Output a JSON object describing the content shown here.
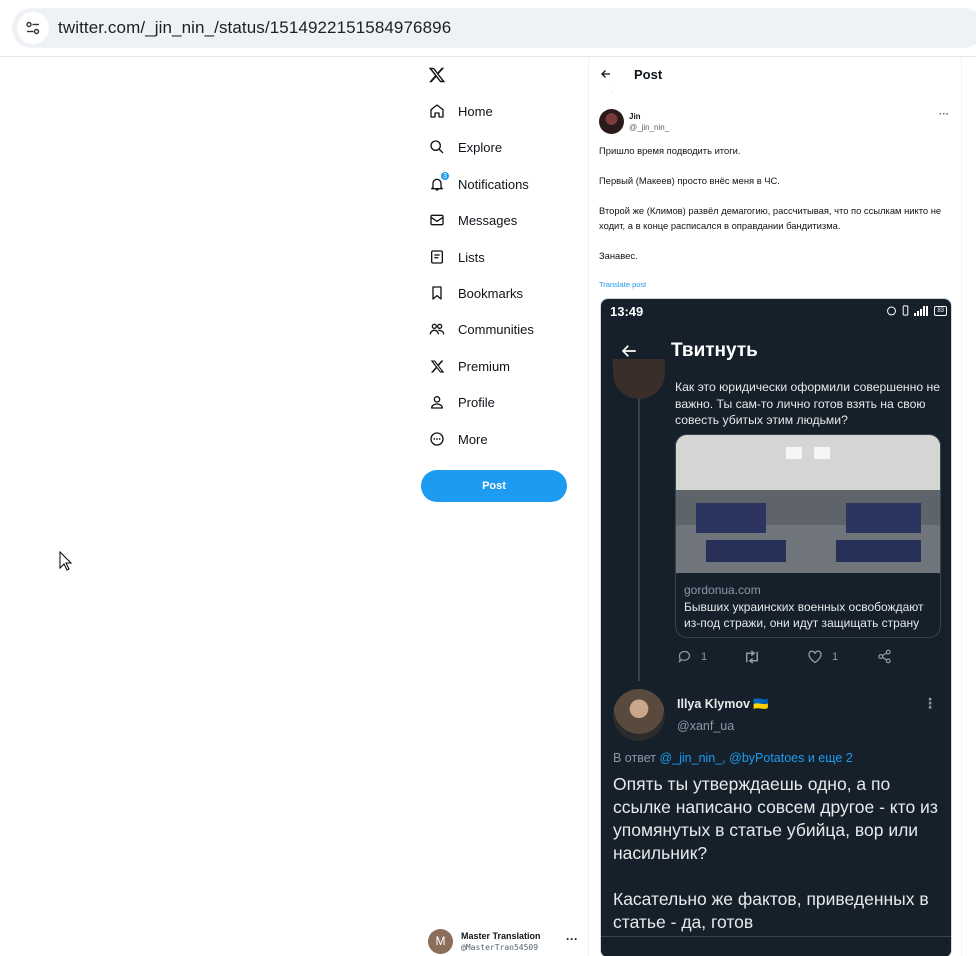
{
  "browser": {
    "url": "twitter.com/_jin_nin_/status/1514922151584976896"
  },
  "nav": {
    "items": [
      {
        "label": "Home",
        "icon": "home-icon"
      },
      {
        "label": "Explore",
        "icon": "search-icon"
      },
      {
        "label": "Notifications",
        "icon": "bell-icon",
        "badge": "3"
      },
      {
        "label": "Messages",
        "icon": "envelope-icon"
      },
      {
        "label": "Lists",
        "icon": "list-icon"
      },
      {
        "label": "Bookmarks",
        "icon": "bookmark-icon"
      },
      {
        "label": "Communities",
        "icon": "people-icon"
      },
      {
        "label": "Premium",
        "icon": "x-logo-icon"
      },
      {
        "label": "Profile",
        "icon": "person-icon"
      },
      {
        "label": "More",
        "icon": "more-circle-icon"
      }
    ],
    "post_label": "Post"
  },
  "account": {
    "name": "Master Translation",
    "handle": "@MasterTran54509",
    "initial": "M"
  },
  "main": {
    "header_title": "Post",
    "tweet": {
      "author_name": "Jin",
      "author_handle": "@_jin_nin_",
      "paragraphs": [
        "Пришло время подводить итоги.",
        "Первый (Макеев) просто внёс меня в ЧС.",
        "Второй же (Климов) развёл демагогию, рассчитывая, что по ссылкам никто не ходит, а в конце расписался в оправдании бандитизма.",
        "Занавес."
      ],
      "translate_label": "Translate post"
    },
    "screenshot": {
      "time": "13:49",
      "battery": "83",
      "header_title": "Твитнуть",
      "prev_tweet_text": "Как это юридически оформили совершенно не важно. Ты сам-то лично готов взять на свою совесть убитых этим людьми?",
      "card_domain": "gordonua.com",
      "card_title": "Бывших украинских военных освобождают из-под стражи, они идут защищать страну",
      "reply_count": "1",
      "like_count": "1",
      "reply_author": "Illya Klymov 🇺🇦",
      "reply_handle": "@xanf_ua",
      "reply_to_prefix": "В ответ",
      "reply_to_mentions": "@_jin_nin_, @byPotatoes и еще 2",
      "reply_paragraphs": [
        "Опять ты утверждаешь одно, а по ссылке написано совсем другое - кто из упомянутых в статье убийца, вор или насильник?",
        "Касательно же фактов, приведенных в статье - да, готов"
      ]
    }
  },
  "colors": {
    "accent": "#1d9bf0",
    "dark_bg": "#15202b",
    "text": "#0f1419",
    "muted": "#536471"
  }
}
